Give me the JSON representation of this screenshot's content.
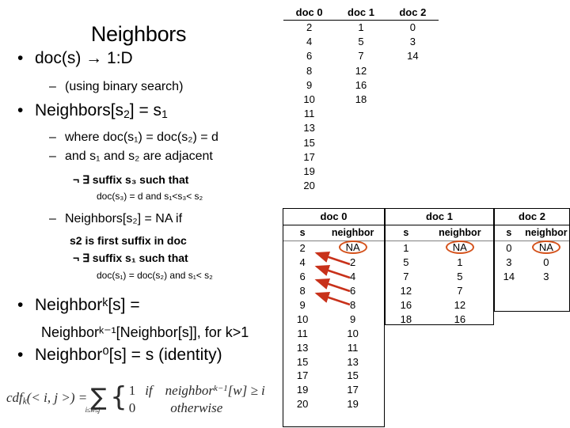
{
  "slide": {
    "title": "Neighbors"
  },
  "outline": {
    "bullet1": "doc(s) → 1:D",
    "sub1": "(using binary search)",
    "bullet2_pre": "Neighbors[s",
    "bullet2_sub": "2",
    "bullet2_mid": "] = s",
    "bullet2_sub2": "1",
    "sub2": "where doc(s₁) = doc(s₂) = d",
    "sub3": "and s₁ and s₂ are adjacent",
    "sub3_note": "¬ ∃ suffix s₃ such that",
    "sub3_note2": "doc(s₃) = d and s₁<s₃< s₂",
    "sub4": "Neighbors[s₂] = NA if",
    "sub4_note1": "s2 is first suffix in doc",
    "sub4_note2": "¬ ∃ suffix s₁ such that",
    "sub4_note3": "doc(s₁) = doc(s₂) and s₁< s₂",
    "bullet3": "Neighborᵏ[s] =",
    "bullet3_cont": "Neighborᵏ⁻¹[Neighbor[s]], for k>1",
    "bullet4": "Neighbor⁰[s] = s (identity)",
    "bullet_glyph": "•",
    "dash_glyph": "–",
    "neg_exists": "¬ ∃"
  },
  "formula": {
    "lhs": "cdf",
    "lhs_sub": "k",
    "lhs_args": "(< i, j >) =",
    "sum_glyph": "∑",
    "sum_sub": "i≤w≤j",
    "case1_value": "1",
    "case1_if": "if",
    "case1_cond": "neighbor",
    "case1_cond_sup": "k−1",
    "case1_cond_rest": "[w] ≥ i",
    "case2_value": "0",
    "case2_text": "otherwise"
  },
  "doc_table": {
    "headers": [
      "doc 0",
      "doc 1",
      "doc 2"
    ],
    "columns": [
      [
        "2",
        "4",
        "6",
        "8",
        "9",
        "10",
        "11",
        "13",
        "15",
        "17",
        "19",
        "20"
      ],
      [
        "1",
        "5",
        "7",
        "12",
        "16",
        "18",
        "",
        "",
        "",
        "",
        "",
        ""
      ],
      [
        "0",
        "3",
        "14",
        "",
        "",
        "",
        "",
        "",
        "",
        "",
        "",
        ""
      ]
    ]
  },
  "neighbor_tables": {
    "col_headers": [
      "s",
      "neighbor"
    ],
    "na_label": "NA",
    "tables": [
      {
        "doc_label": "doc 0",
        "rows": [
          [
            "2",
            "NA"
          ],
          [
            "4",
            "2"
          ],
          [
            "6",
            "4"
          ],
          [
            "8",
            "6"
          ],
          [
            "9",
            "8"
          ],
          [
            "10",
            "9"
          ],
          [
            "11",
            "10"
          ],
          [
            "13",
            "11"
          ],
          [
            "15",
            "13"
          ],
          [
            "17",
            "15"
          ],
          [
            "19",
            "17"
          ],
          [
            "20",
            "19"
          ]
        ]
      },
      {
        "doc_label": "doc 1",
        "rows": [
          [
            "1",
            "NA"
          ],
          [
            "5",
            "1"
          ],
          [
            "7",
            "5"
          ],
          [
            "12",
            "7"
          ],
          [
            "16",
            "12"
          ],
          [
            "18",
            "16"
          ]
        ]
      },
      {
        "doc_label": "doc 2",
        "rows": [
          [
            "0",
            "NA"
          ],
          [
            "3",
            "0"
          ],
          [
            "14",
            "3"
          ]
        ]
      }
    ]
  },
  "colors": {
    "annotation": "#D4521C",
    "arrow": "#C8311A",
    "text": "#000000"
  }
}
